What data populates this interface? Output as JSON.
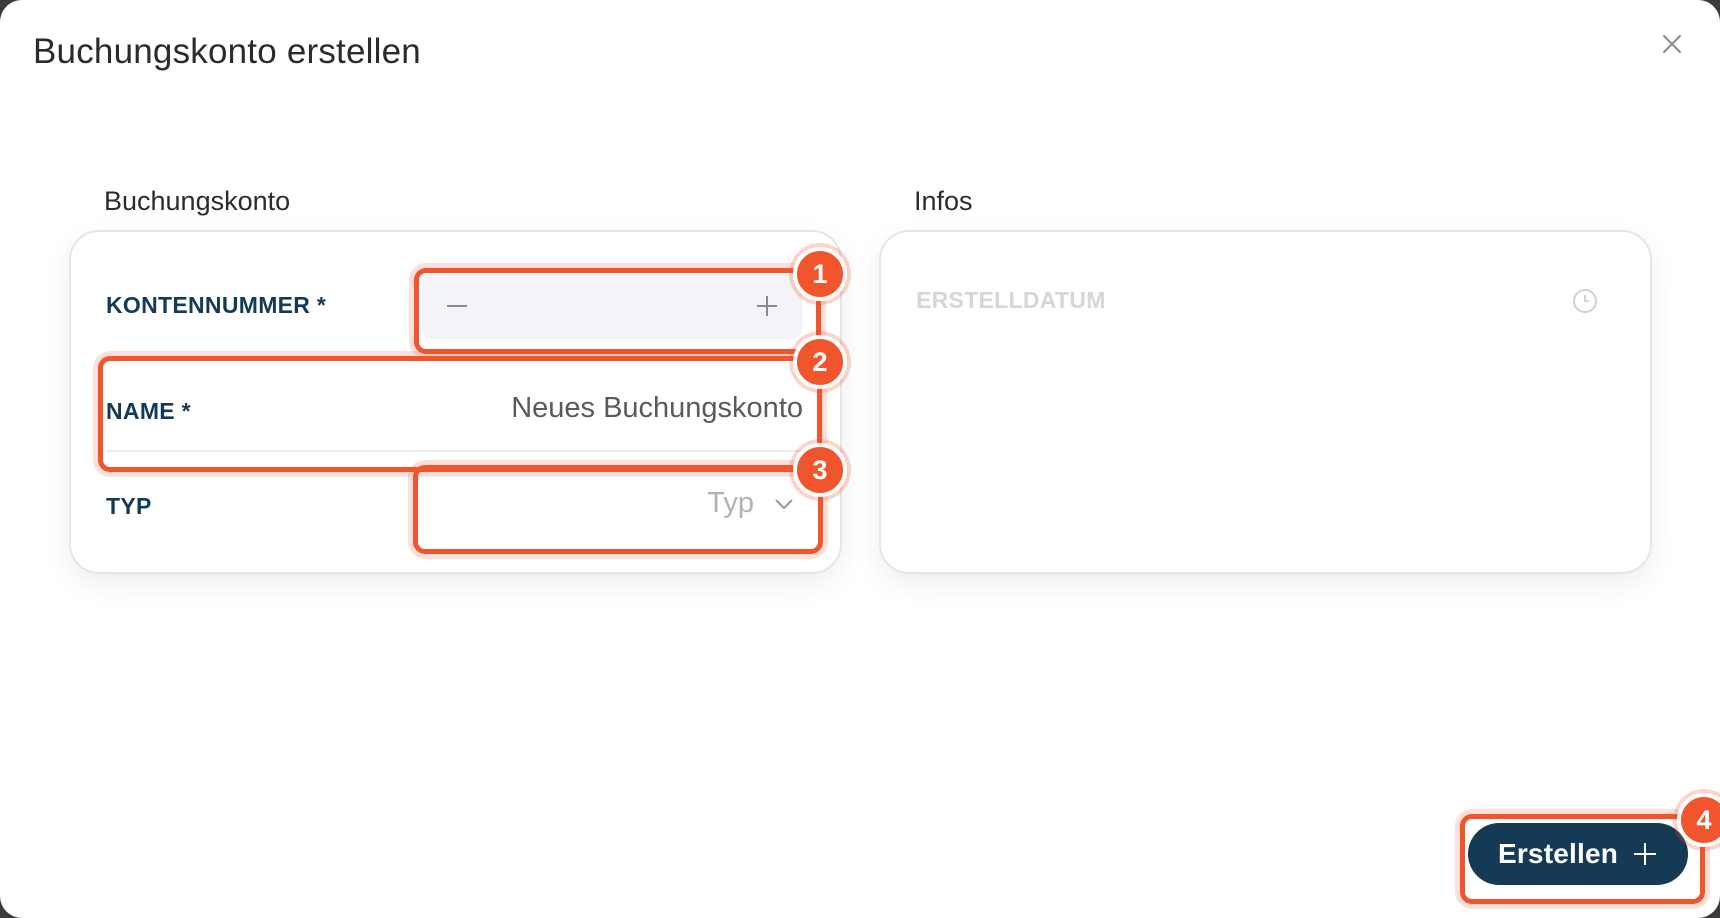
{
  "dialog": {
    "title": "Buchungskonto erstellen"
  },
  "left_section": {
    "title": "Buchungskonto",
    "fields": {
      "account_number": {
        "label": "KONTENNUMMER *",
        "value": ""
      },
      "name": {
        "label": "NAME *",
        "value": "Neues Buchungskonto"
      },
      "type": {
        "label": "TYP",
        "placeholder": "Typ"
      }
    }
  },
  "right_section": {
    "title": "Infos",
    "created_date_label": "ERSTELLDATUM"
  },
  "footer": {
    "submit_label": "Erstellen"
  },
  "annotations": [
    "1",
    "2",
    "3",
    "4"
  ],
  "colors": {
    "primary": "#143a56",
    "highlight": "#f0552e",
    "label": "#143a56",
    "muted": "#d4d6d9"
  },
  "icons": {
    "close": "close-icon",
    "minus": "minus-icon",
    "plus": "plus-icon",
    "chevron": "chevron-down-icon",
    "clock": "clock-icon",
    "submit_plus": "plus-icon"
  }
}
